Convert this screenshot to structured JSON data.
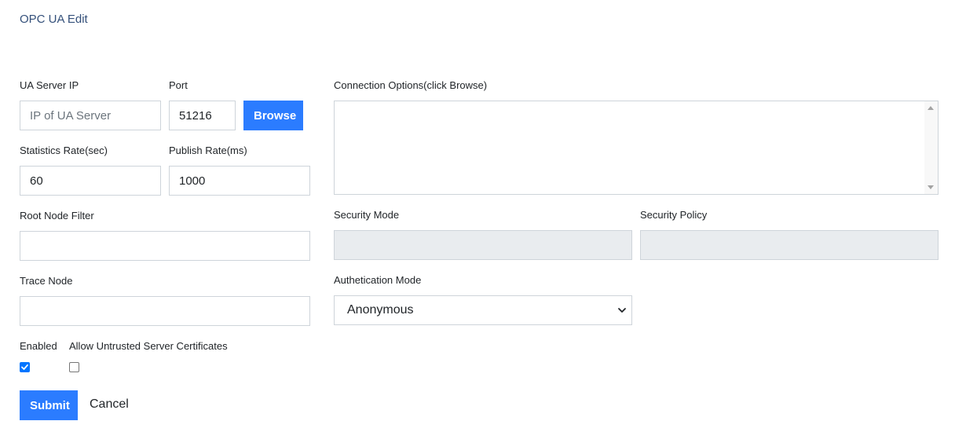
{
  "page": {
    "title": "OPC UA Edit"
  },
  "form": {
    "ua_server_ip": {
      "label": "UA Server IP",
      "value": "",
      "placeholder": "IP of UA Server"
    },
    "port": {
      "label": "Port",
      "value": "51216"
    },
    "browse_label": "Browse",
    "statistics_rate": {
      "label": "Statistics Rate(sec)",
      "value": "60"
    },
    "publish_rate": {
      "label": "Publish Rate(ms)",
      "value": "1000"
    },
    "root_node_filter": {
      "label": "Root Node Filter",
      "value": ""
    },
    "trace_node": {
      "label": "Trace Node",
      "value": ""
    },
    "connection_options": {
      "label": "Connection Options(click Browse)",
      "value": ""
    },
    "security_mode": {
      "label": "Security Mode",
      "value": ""
    },
    "security_policy": {
      "label": "Security Policy",
      "value": ""
    },
    "authentication_mode": {
      "label": "Authetication Mode",
      "selected": "Anonymous"
    },
    "enabled": {
      "label": "Enabled",
      "checked": true
    },
    "allow_untrusted": {
      "label": "Allow Untrusted Server Certificates",
      "checked": false
    },
    "submit_label": "Submit",
    "cancel_label": "Cancel"
  },
  "colors": {
    "accent": "#2b7cff",
    "title": "#34507a",
    "disabled_bg": "#e9ecef",
    "border": "#ced4da"
  }
}
